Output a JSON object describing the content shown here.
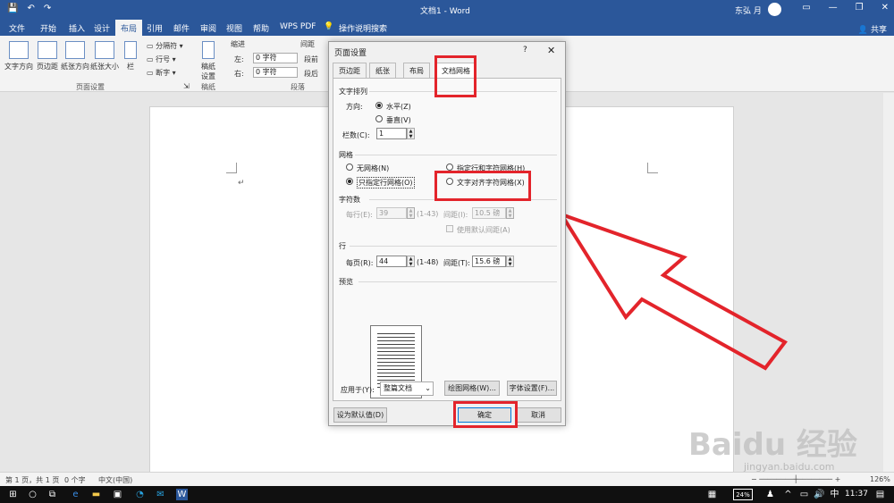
{
  "titlebar": {
    "title": "文档1 - Word",
    "user": "东弘 月",
    "qat": [
      "💾",
      "↶",
      "↷"
    ]
  },
  "tabs": [
    "文件",
    "开始",
    "插入",
    "设计",
    "布局",
    "引用",
    "邮件",
    "审阅",
    "视图",
    "帮助",
    "WPS PDF",
    "操作说明搜索"
  ],
  "share": "共享",
  "ribbon": {
    "text_direction": "文字方向",
    "margins": "页边距",
    "orientation": "纸张方向",
    "size": "纸张大小",
    "columns": "栏",
    "breaks": "分隔符",
    "line_numbers": "行号",
    "hyphenation": "断字",
    "page_setup_group": "页面设置",
    "draft_paper": "稿纸\n设置",
    "draft_group": "稿纸",
    "indent": "缩进",
    "spacing": "间距",
    "left_label": "左:",
    "left_value": "0 字符",
    "right_label": "右:",
    "right_value": "0 字符",
    "before_label": "段前",
    "after_label": "段后",
    "paragraph_group": "段落"
  },
  "status": {
    "page": "第 1 页，共 1 页",
    "words": "0 个字",
    "lang": "中文(中国)",
    "zoom": "126%"
  },
  "clock": "11:37",
  "battery": "24%",
  "dialog": {
    "title": "页面设置",
    "help": "?",
    "close": "✕",
    "tabs": [
      "页边距",
      "纸张",
      "布局",
      "文档网格"
    ],
    "text_direction_section": "文字排列",
    "direction_label": "方向:",
    "horizontal": "水平(Z)",
    "vertical": "垂直(V)",
    "columns_label": "栏数(C):",
    "columns_value": "1",
    "grid_section": "网格",
    "no_grid": "无网格(N)",
    "line_char_grid": "指定行和字符网格(H)",
    "line_grid_only": "只指定行网格(O)",
    "snap_chars": "文字对齐字符网格(X)",
    "chars_section": "字符数",
    "per_line_label": "每行(E):",
    "per_line_value": "39",
    "per_line_range": "(1-43)",
    "char_pitch_label": "间距(I):",
    "char_pitch_value": "10.5 磅",
    "use_default_pitch": "使用默认间距(A)",
    "lines_section": "行",
    "per_page_label": "每页(R):",
    "per_page_value": "44",
    "per_page_range": "(1-48)",
    "line_pitch_label": "间距(T):",
    "line_pitch_value": "15.6 磅",
    "preview_section": "预览",
    "apply_to_label": "应用于(Y):",
    "apply_to_value": "整篇文档",
    "draw_grid": "绘图网格(W)...",
    "font_settings": "字体设置(F)...",
    "set_default": "设为默认值(D)",
    "ok": "确定",
    "cancel": "取消"
  },
  "watermark": "Baidu 经验",
  "watermark_url": "jingyan.baidu.com",
  "colors": {
    "word_blue": "#2b579a",
    "annotation_red": "#e3242b"
  }
}
